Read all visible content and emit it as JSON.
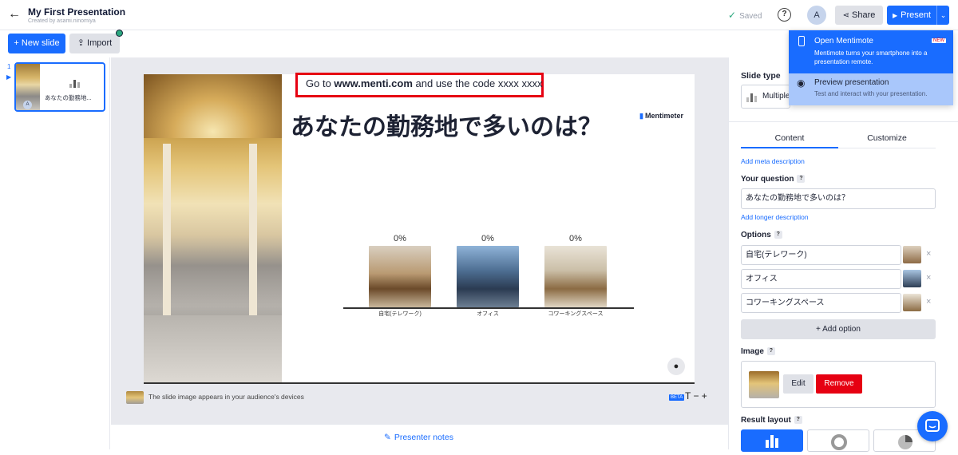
{
  "header": {
    "back_icon": "arrow-left-icon",
    "title": "My First Presentation",
    "created_by": "Created by asami.ninomiya",
    "saved": "Saved",
    "help": "?",
    "avatar": "A",
    "share": "Share",
    "present": "Present"
  },
  "toolbar": {
    "new_slide": "+ New slide",
    "import": "Import"
  },
  "sidebar": {
    "slides": [
      {
        "number": "1",
        "text": "あなたの勤務地...",
        "avatar": "A"
      }
    ]
  },
  "slide": {
    "code_prefix": "Go to ",
    "code_url": "www.menti.com",
    "code_suffix": " and use the code xxxx xxxx",
    "heading": "あなたの勤務地で多いのは？",
    "brand": "Mentimeter",
    "options": [
      {
        "label": "自宅(テレワーク)",
        "percent": "0%"
      },
      {
        "label": "オフィス",
        "percent": "0%"
      },
      {
        "label": "コワーキングスペース",
        "percent": "0%"
      }
    ],
    "audience_note": "The slide image appears in your audience's devices",
    "beta": "BETA",
    "font_controls": "T − +",
    "presenter_notes": "Presenter notes"
  },
  "right_panel": {
    "slide_type_label": "Slide type",
    "slide_type_value": "Multiple",
    "tabs": [
      "Content",
      "Customize"
    ],
    "add_meta": "Add meta description",
    "question_label": "Your question",
    "question_value": "あなたの勤務地で多いのは？",
    "add_longer": "Add longer description",
    "options_label": "Options",
    "options": [
      "自宅(テレワーク)",
      "オフィス",
      "コワーキングスペース"
    ],
    "add_option": "+ Add option",
    "image_label": "Image",
    "edit": "Edit",
    "remove": "Remove",
    "result_layout_label": "Result layout",
    "qmark": "?"
  },
  "dropdown": {
    "item1_title": "Open Mentimote",
    "item1_badge": "NEW",
    "item1_desc": "Mentimote turns your smartphone into a presentation remote.",
    "item2_title": "Preview presentation",
    "item2_desc": "Test and interact with your presentation."
  },
  "colors": {
    "accent": "#196cff",
    "danger": "#e60012",
    "saved_check": "#2ca87f"
  }
}
